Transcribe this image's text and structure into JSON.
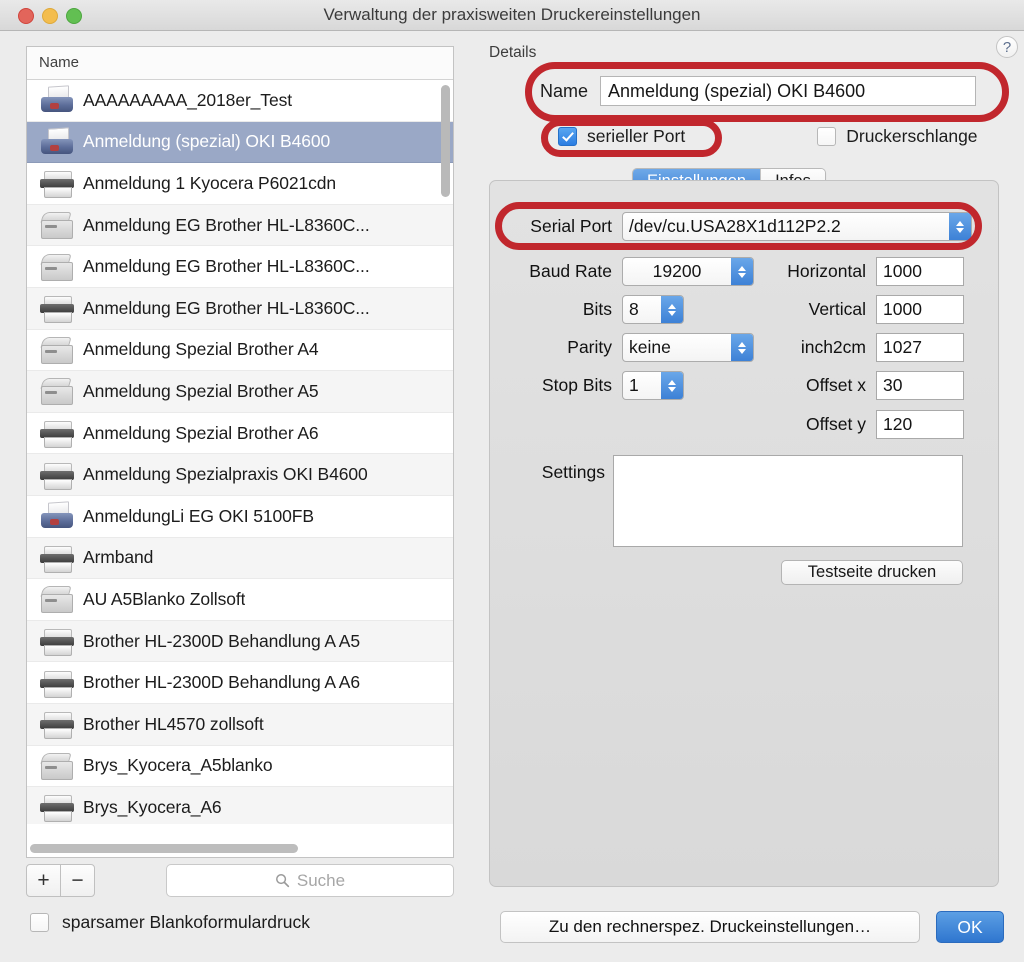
{
  "window": {
    "title": "Verwaltung der praxisweiten Druckereinstellungen",
    "traffic_lights": [
      "close-button",
      "minimize-button",
      "zoom-button"
    ]
  },
  "list_panel": {
    "column_header": "Name",
    "selected_index": 1,
    "rows": [
      {
        "label": "AAAAAAAAA_2018er_Test",
        "icon": "printer-blue-icon"
      },
      {
        "label": "Anmeldung (spezial) OKI B4600",
        "icon": "printer-blue-icon"
      },
      {
        "label": "Anmeldung 1 Kyocera P6021cdn",
        "icon": "printer-grey-icon"
      },
      {
        "label": "Anmeldung EG Brother HL-L8360C...",
        "icon": "printer-box-icon"
      },
      {
        "label": "Anmeldung EG Brother HL-L8360C...",
        "icon": "printer-box-icon"
      },
      {
        "label": "Anmeldung EG Brother HL-L8360C...",
        "icon": "printer-grey-icon"
      },
      {
        "label": "Anmeldung Spezial Brother A4",
        "icon": "printer-box-icon"
      },
      {
        "label": "Anmeldung Spezial Brother A5",
        "icon": "printer-box-icon"
      },
      {
        "label": "Anmeldung Spezial Brother A6",
        "icon": "printer-grey-icon"
      },
      {
        "label": "Anmeldung Spezialpraxis OKI B4600",
        "icon": "printer-grey-icon"
      },
      {
        "label": "AnmeldungLi EG OKI 5100FB",
        "icon": "printer-blue-icon"
      },
      {
        "label": "Armband",
        "icon": "printer-grey-icon"
      },
      {
        "label": "AU A5Blanko Zollsoft",
        "icon": "printer-box-icon"
      },
      {
        "label": "Brother HL-2300D Behandlung A A5",
        "icon": "printer-grey-icon"
      },
      {
        "label": "Brother HL-2300D Behandlung A A6",
        "icon": "printer-grey-icon"
      },
      {
        "label": "Brother HL4570 zollsoft",
        "icon": "printer-grey-icon"
      },
      {
        "label": "Brys_Kyocera_A5blanko",
        "icon": "printer-box-icon"
      },
      {
        "label": "Brys_Kyocera_A6",
        "icon": "printer-grey-icon"
      },
      {
        "label": "",
        "icon": "printer-box-icon"
      }
    ],
    "toolbar": {
      "add_label": "+",
      "remove_label": "−",
      "search_placeholder": "Suche",
      "search_value": "",
      "search_icon": "search-icon"
    }
  },
  "sparsam": {
    "label": "sparsamer Blankoformulardruck",
    "checked": false
  },
  "details": {
    "title": "Details",
    "help_label": "?",
    "name": {
      "label": "Name",
      "value": "Anmeldung (spezial) OKI B4600"
    },
    "checkboxes": {
      "serial_port": {
        "label": "serieller Port",
        "checked": true
      },
      "print_queue": {
        "label": "Druckerschlange",
        "checked": false
      }
    },
    "tabs": [
      {
        "label": "Einstellungen",
        "active": true
      },
      {
        "label": "Infos",
        "active": false
      }
    ],
    "fields": {
      "serial_port": {
        "label": "Serial Port",
        "value": "/dev/cu.USA28X1d112P2.2",
        "type": "popup"
      },
      "baud_rate": {
        "label": "Baud Rate",
        "value": "19200",
        "type": "popup"
      },
      "bits": {
        "label": "Bits",
        "value": "8",
        "type": "popup"
      },
      "parity": {
        "label": "Parity",
        "value": "keine",
        "type": "popup"
      },
      "stop_bits": {
        "label": "Stop Bits",
        "value": "1",
        "type": "popup"
      },
      "horizontal": {
        "label": "Horizontal",
        "value": "1000",
        "type": "text"
      },
      "vertical": {
        "label": "Vertical",
        "value": "1000",
        "type": "text"
      },
      "inch2cm": {
        "label": "inch2cm",
        "value": "1027",
        "type": "text"
      },
      "offset_x": {
        "label": "Offset x",
        "value": "30",
        "type": "text"
      },
      "offset_y": {
        "label": "Offset y",
        "value": "120",
        "type": "text"
      },
      "settings": {
        "label": "Settings",
        "value": "",
        "type": "textarea"
      }
    },
    "test_page_button": "Testseite drucken"
  },
  "footer": {
    "secondary_button": "Zu den rechnerspez. Druckeinstellungen…",
    "primary_button": "OK"
  },
  "annotations": {
    "color": "#c1272d",
    "highlighted": [
      "name-field",
      "serial-port-checkbox",
      "serial-port-popup"
    ]
  }
}
